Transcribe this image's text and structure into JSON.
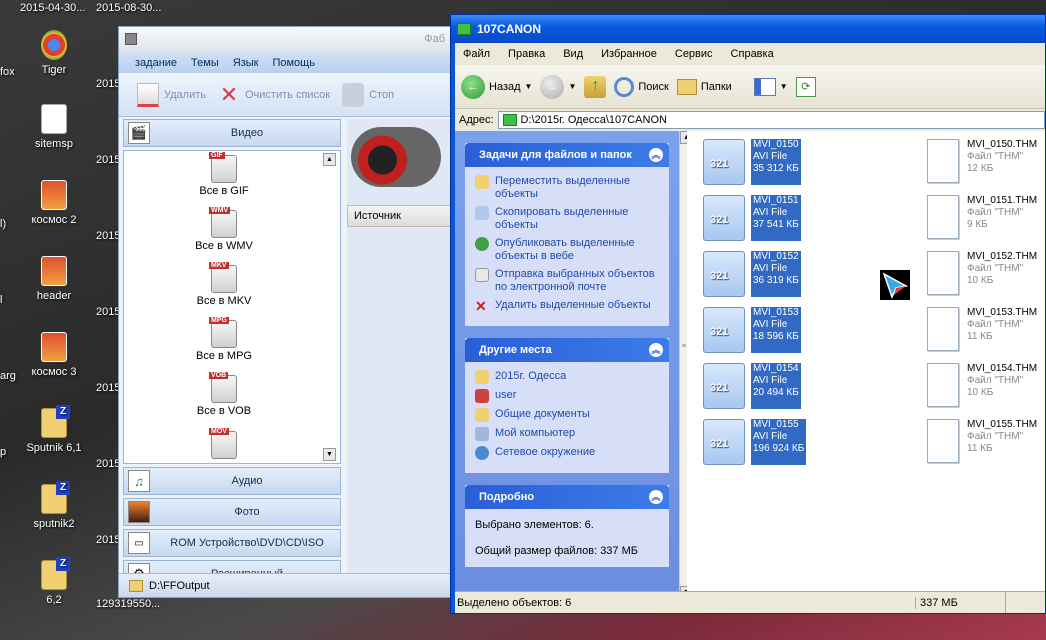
{
  "desktop": {
    "top_labels": [
      "2015-04-30...",
      "2015-08-30..."
    ],
    "icons": [
      {
        "label": "Tiger",
        "type": "chrome"
      },
      {
        "label": "sitemsp",
        "type": "doc"
      },
      {
        "label": "космос 2",
        "type": "img"
      },
      {
        "label": "header",
        "type": "img"
      },
      {
        "label": "космос 3",
        "type": "img"
      },
      {
        "label": "Sputnik 6,1",
        "type": "zip"
      },
      {
        "label": "sputnik2",
        "type": "zip"
      },
      {
        "label": "6,2",
        "type": "zip"
      }
    ],
    "left_partial": [
      "fox",
      "l)",
      "l",
      "arg",
      "p"
    ],
    "mid_partial": [
      "2015",
      "2015",
      "2015",
      "2015",
      "2015",
      "2015",
      "2015",
      "2015",
      "129319550..."
    ]
  },
  "ffactory": {
    "title": "Фаб",
    "menu": [
      "задание",
      "Темы",
      "Язык",
      "Помощь"
    ],
    "toolbar": [
      "Удалить",
      "Очистить список",
      "Стоп"
    ],
    "categories": {
      "video": "Видео",
      "audio": "Аудио",
      "photo": "Фото",
      "rom": "ROM Устройство\\DVD\\CD\\ISO",
      "advanced": "Расширенный"
    },
    "video_items": [
      {
        "badge": "GIF",
        "label": "Все в GIF"
      },
      {
        "badge": "WMV",
        "label": "Все в WMV"
      },
      {
        "badge": "MKV",
        "label": "Все в MKV"
      },
      {
        "badge": "MPG",
        "label": "Все в MPG"
      },
      {
        "badge": "VOB",
        "label": "Все в VOB"
      },
      {
        "badge": "MOV",
        "label": ""
      }
    ],
    "source_header": "Источник",
    "output_path": "D:\\FFOutput"
  },
  "explorer": {
    "title": "107CANON",
    "menu": [
      "Файл",
      "Правка",
      "Вид",
      "Избранное",
      "Сервис",
      "Справка"
    ],
    "toolbar": {
      "back": "Назад",
      "search": "Поиск",
      "folders": "Папки"
    },
    "address_label": "Адрес:",
    "address": "D:\\2015г. Одесса\\107CANON",
    "tasks": {
      "title": "Задачи для файлов и папок",
      "items": [
        "Переместить выделенные объекты",
        "Скопировать выделенные объекты",
        "Опубликовать выделенные объекты в вебе",
        "Отправка выбранных объектов по электронной почте",
        "Удалить выделенные объекты"
      ]
    },
    "places": {
      "title": "Другие места",
      "items": [
        "2015г. Одесса",
        "user",
        "Общие документы",
        "Мой компьютер",
        "Сетевое окружение"
      ]
    },
    "details": {
      "title": "Подробно",
      "selected": "Выбрано элементов: 6.",
      "total": "Общий размер файлов: 337 МБ"
    },
    "avi_files": [
      {
        "name": "MVI_0150",
        "type": "AVI File",
        "size": "35 312 КБ"
      },
      {
        "name": "MVI_0151",
        "type": "AVI File",
        "size": "37 541 КБ"
      },
      {
        "name": "MVI_0152",
        "type": "AVI File",
        "size": "36 319 КБ"
      },
      {
        "name": "MVI_0153",
        "type": "AVI File",
        "size": "18 596 КБ"
      },
      {
        "name": "MVI_0154",
        "type": "AVI File",
        "size": "20 494 КБ"
      },
      {
        "name": "MVI_0155",
        "type": "AVI File",
        "size": "196 924 КБ"
      }
    ],
    "thm_files": [
      {
        "name": "MVI_0150.THM",
        "type": "Файл \"THM\"",
        "size": "12 КБ"
      },
      {
        "name": "MVI_0151.THM",
        "type": "Файл \"THM\"",
        "size": "9 КБ"
      },
      {
        "name": "MVI_0152.THM",
        "type": "Файл \"THM\"",
        "size": "10 КБ"
      },
      {
        "name": "MVI_0153.THM",
        "type": "Файл \"THM\"",
        "size": "11 КБ"
      },
      {
        "name": "MVI_0154.THM",
        "type": "Файл \"THM\"",
        "size": "10 КБ"
      },
      {
        "name": "MVI_0155.THM",
        "type": "Файл \"THM\"",
        "size": "11 КБ"
      }
    ],
    "status": {
      "left": "Выделено объектов: 6",
      "right": "337 МБ"
    }
  }
}
